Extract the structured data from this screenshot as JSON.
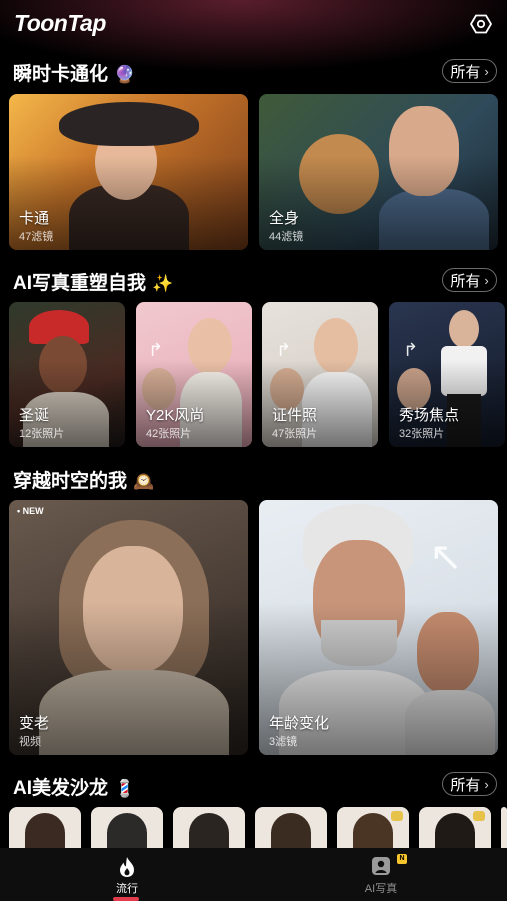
{
  "app": {
    "logo": "ToonTap"
  },
  "sections": [
    {
      "title": "瞬时卡通化",
      "emoji": "🔮",
      "all": "所有"
    },
    {
      "title": "AI写真重塑自我",
      "emoji": "✨",
      "all": "所有"
    },
    {
      "title": "穿越时空的我",
      "emoji": "🕰️"
    },
    {
      "title": "AI美发沙龙",
      "emoji": "💈",
      "all": "所有"
    }
  ],
  "cartoon_cards": [
    {
      "label": "卡通",
      "sub": "47滤镜"
    },
    {
      "label": "全身",
      "sub": "44滤镜"
    }
  ],
  "portrait_cards": [
    {
      "label": "圣诞",
      "sub": "12张照片"
    },
    {
      "label": "Y2K风尚",
      "sub": "42张照片"
    },
    {
      "label": "证件照",
      "sub": "47张照片"
    },
    {
      "label": "秀场焦点",
      "sub": "32张照片"
    }
  ],
  "time_cards": [
    {
      "label": "变老",
      "sub": "视频",
      "badge": "• NEW"
    },
    {
      "label": "年龄变化",
      "sub": "3滤镜"
    }
  ],
  "tabs": [
    {
      "label": "流行",
      "active": true,
      "icon": "flame-icon"
    },
    {
      "label": "AI写真",
      "active": false,
      "icon": "portrait-icon",
      "badge": "N"
    }
  ],
  "colors": {
    "accent": "#e23b4e",
    "background": "#000000",
    "badge": "#f5c52b"
  }
}
